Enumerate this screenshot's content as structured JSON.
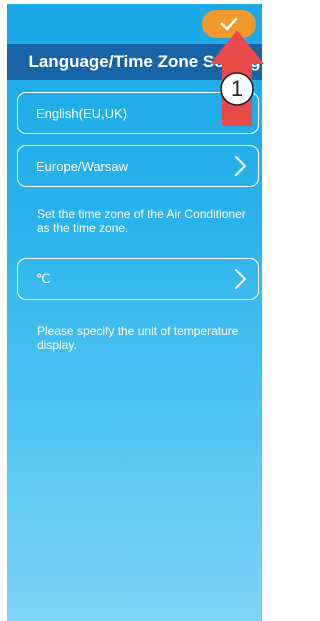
{
  "header": {
    "title": "Language/Time Zone Setting",
    "confirm_icon": "check-icon"
  },
  "settings": {
    "language_value": "English(EU,UK)",
    "timezone_value": "Europe/Warsaw",
    "timezone_hint": "Set the time zone of the Air Conditioner as the time zone.",
    "unit_value": "℃",
    "unit_hint": "Please specify the unit of temperature display."
  },
  "annotation": {
    "step_number": "1"
  },
  "colors": {
    "accent_orange": "#f09a2b",
    "title_bar": "#1765a6",
    "background_top": "#1aa8e6",
    "annotation_arrow": "#e84a4a"
  }
}
